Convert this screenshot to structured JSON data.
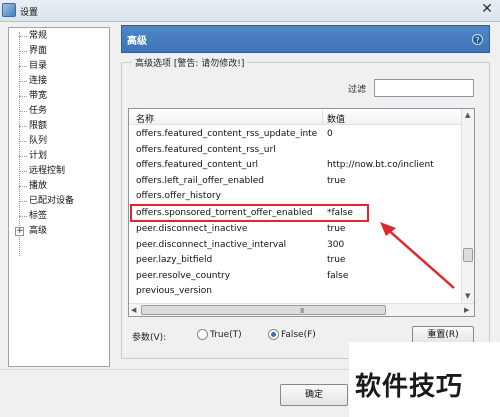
{
  "window": {
    "title": "设置",
    "close": "✕"
  },
  "sidebar": {
    "items": [
      {
        "label": "常规"
      },
      {
        "label": "界面"
      },
      {
        "label": "目录"
      },
      {
        "label": "连接"
      },
      {
        "label": "带宽"
      },
      {
        "label": "任务"
      },
      {
        "label": "限额"
      },
      {
        "label": "队列"
      },
      {
        "label": "计划"
      },
      {
        "label": "远程控制"
      },
      {
        "label": "播放"
      },
      {
        "label": "已配对设备"
      },
      {
        "label": "标签"
      },
      {
        "label": "高级",
        "expander": "+"
      }
    ]
  },
  "panel": {
    "title": "高级",
    "help": "?",
    "group_title": "高级选项 [警告: 请勿修改!]",
    "filter_label": "过滤",
    "filter_value": ""
  },
  "list": {
    "columns": {
      "name": "名称",
      "value": "数值"
    },
    "rows": [
      {
        "name": "offers.featured_content_rss_update_interv...",
        "value": "0"
      },
      {
        "name": "offers.featured_content_rss_url",
        "value": ""
      },
      {
        "name": "offers.featured_content_url",
        "value": "http://now.bt.co/inclient"
      },
      {
        "name": "offers.left_rail_offer_enabled",
        "value": "true"
      },
      {
        "name": "offers.offer_history",
        "value": ""
      },
      {
        "name": "offers.sponsored_torrent_offer_enabled",
        "value": "*false"
      },
      {
        "name": "peer.disconnect_inactive",
        "value": "true"
      },
      {
        "name": "peer.disconnect_inactive_interval",
        "value": "300"
      },
      {
        "name": "peer.lazy_bitfield",
        "value": "true"
      },
      {
        "name": "peer.resolve_country",
        "value": "false"
      },
      {
        "name": "previous_version",
        "value": ""
      }
    ],
    "scroll_grip": "III"
  },
  "params": {
    "label": "参数(V):",
    "true_label": "True(T)",
    "false_label": "False(F)",
    "selected": "false",
    "reset_label": "重置(R)"
  },
  "footer": {
    "ok_label": "确定"
  },
  "watermark": "软件技巧",
  "colors": {
    "highlight": "#e0272d",
    "header": "#4680c2"
  }
}
